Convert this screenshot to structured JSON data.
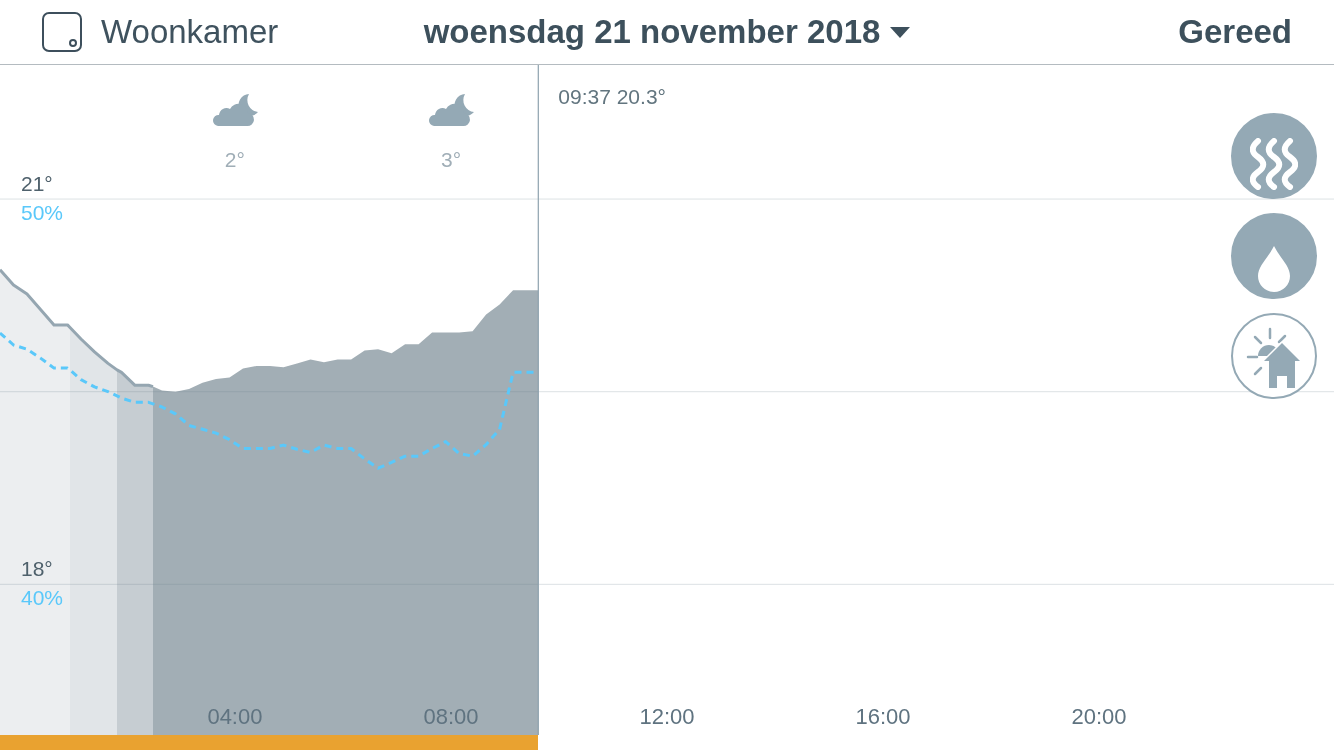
{
  "header": {
    "room": "Woonkamer",
    "date": "woensdag 21 november 2018",
    "done": "Gereed"
  },
  "weather": [
    {
      "temperature": "2°"
    },
    {
      "temperature": "3°"
    }
  ],
  "chart": {
    "chart_data": {
      "type": "area",
      "x": [
        -0.35,
        -0.1,
        0.15,
        0.4,
        0.65,
        0.9,
        0.946,
        1.15,
        1.4,
        1.65,
        1.817,
        1.9,
        2.15,
        2.4,
        2.483,
        2.65,
        2.9,
        3.15,
        3.4,
        3.65,
        3.9,
        4.15,
        4.4,
        4.65,
        4.9,
        5.15,
        5.4,
        5.65,
        5.9,
        6.15,
        6.4,
        6.65,
        6.9,
        7.15,
        7.4,
        7.65,
        7.9,
        8.15,
        8.4,
        8.65,
        8.9,
        9.15,
        9.617
      ],
      "series": [
        {
          "color": "#eceef0",
          "values": [
            20.45,
            20.33,
            20.26,
            20.14,
            20.02,
            20.02,
            20.0,
            null,
            null,
            null,
            null,
            null,
            null,
            null,
            null,
            null,
            null,
            null,
            null,
            null,
            null,
            null,
            null,
            null,
            null,
            null,
            null,
            null,
            null,
            null,
            null,
            null,
            null,
            null,
            null,
            null,
            null,
            null,
            null,
            null,
            null,
            null,
            null
          ]
        },
        {
          "color": "#e1e5e8",
          "values": [
            null,
            null,
            null,
            null,
            null,
            null,
            20.0,
            19.91,
            19.81,
            19.72,
            19.67,
            null,
            null,
            null,
            null,
            null,
            null,
            null,
            null,
            null,
            null,
            null,
            null,
            null,
            null,
            null,
            null,
            null,
            null,
            null,
            null,
            null,
            null,
            null,
            null,
            null,
            null,
            null,
            null,
            null,
            null,
            null,
            null
          ]
        },
        {
          "color": "#c6cdd2",
          "values": [
            null,
            null,
            null,
            null,
            null,
            null,
            null,
            null,
            null,
            null,
            19.67,
            19.65,
            19.55,
            19.55,
            19.54,
            null,
            null,
            null,
            null,
            null,
            null,
            null,
            null,
            null,
            null,
            null,
            null,
            null,
            null,
            null,
            null,
            null,
            null,
            null,
            null,
            null,
            null,
            null,
            null,
            null,
            null,
            null,
            null
          ]
        },
        {
          "color": "#a2aeb5",
          "values": [
            null,
            null,
            null,
            null,
            null,
            null,
            null,
            null,
            null,
            null,
            null,
            null,
            null,
            null,
            19.54,
            19.51,
            19.5,
            19.52,
            19.57,
            19.6,
            19.61,
            19.68,
            19.7,
            19.7,
            19.69,
            19.72,
            19.75,
            19.73,
            19.75,
            19.75,
            19.82,
            19.83,
            19.8,
            19.87,
            19.87,
            19.96,
            19.96,
            19.96,
            19.97,
            20.1,
            20.18,
            20.29,
            20.29
          ]
        },
        {
          "color": "#95a6b1",
          "type": "line",
          "line_style": "solid",
          "values": [
            20.45,
            20.33,
            20.26,
            20.14,
            20.02,
            20.02,
            20.0,
            19.91,
            19.81,
            19.72,
            19.67,
            19.65,
            19.55,
            19.55,
            19.54,
            null,
            null,
            null,
            null,
            null,
            null,
            null,
            null,
            null,
            null,
            null,
            null,
            null,
            null,
            null,
            null,
            null,
            null,
            null,
            null,
            null,
            null,
            null,
            null,
            null,
            null,
            null,
            null
          ]
        },
        {
          "color": "#5ac8fa",
          "type": "line",
          "line_style": "dashed",
          "axis": "y2",
          "values": [
            46.52,
            46.21,
            46.1,
            45.87,
            45.61,
            45.61,
            45.56,
            45.31,
            45.12,
            45.0,
            44.89,
            44.83,
            44.72,
            44.72,
            44.68,
            44.6,
            44.42,
            44.12,
            44.02,
            43.92,
            43.75,
            43.52,
            43.52,
            43.52,
            43.61,
            43.5,
            43.42,
            43.61,
            43.52,
            43.52,
            43.25,
            43.01,
            43.16,
            43.32,
            43.32,
            43.52,
            43.7,
            43.39,
            43.32,
            43.62,
            44.02,
            45.5,
            45.5
          ]
        }
      ],
      "xlim": [
        -0.35,
        24.35
      ],
      "ylim": [
        16.71,
        22.55
      ],
      "y2lim": [
        35.69,
        55.17
      ],
      "xticks": [
        {
          "value": 4,
          "label": "04:00"
        },
        {
          "value": 8,
          "label": "08:00"
        },
        {
          "value": 12,
          "label": "12:00"
        },
        {
          "value": 16,
          "label": "16:00"
        },
        {
          "value": 20,
          "label": "20:00"
        }
      ],
      "yticks": [
        {
          "value": 21,
          "label": "21°"
        },
        {
          "value": 18,
          "label": "18°"
        }
      ],
      "y2ticks": [
        {
          "value": 50,
          "label": "50%"
        },
        {
          "value": 40,
          "label": "40%"
        }
      ],
      "ref_lines": [
        {
          "axis": "y",
          "value": 19.5
        },
        {
          "axis": "x",
          "value": 9.617
        }
      ],
      "annotations": [
        "09:37 20.3°"
      ]
    }
  },
  "toggles": [
    {
      "kind": "heating",
      "on": true
    },
    {
      "kind": "humidity",
      "on": true
    },
    {
      "kind": "sunlight",
      "on": false
    }
  ]
}
